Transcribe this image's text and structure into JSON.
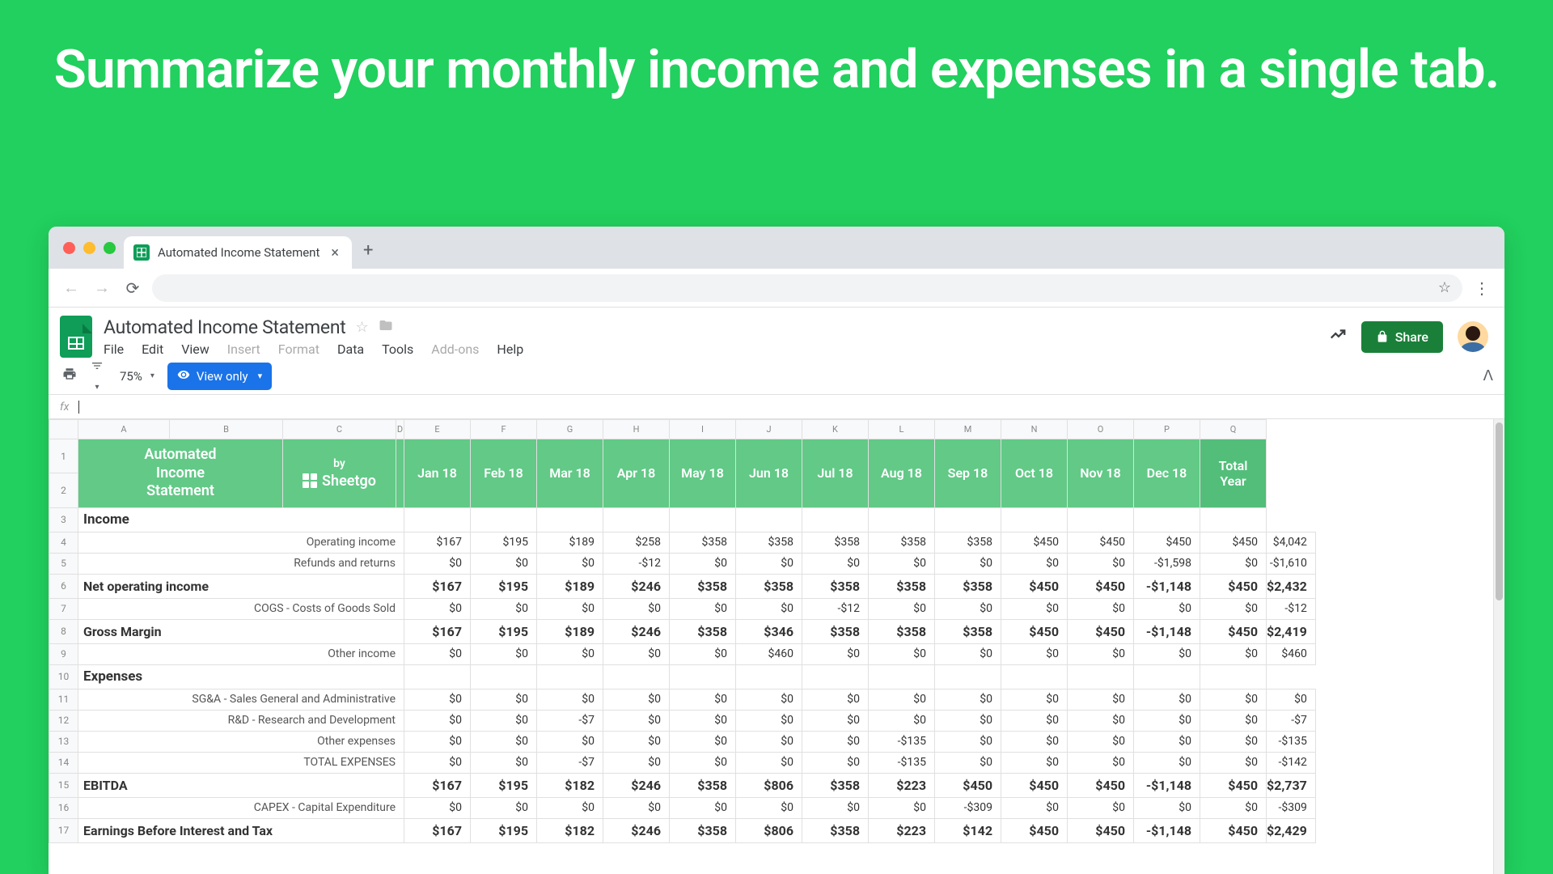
{
  "hero": "Summarize your monthly income and expenses in a single tab.",
  "tab": {
    "title": "Automated Income Statement"
  },
  "doc": {
    "title": "Automated Income Statement",
    "menus": [
      "File",
      "Edit",
      "View",
      "Insert",
      "Format",
      "Data",
      "Tools",
      "Add-ons",
      "Help"
    ],
    "menus_dim": [
      "Insert",
      "Format",
      "Add-ons"
    ],
    "share_label": "Share"
  },
  "toolbar": {
    "zoom": "75%",
    "view_only": "View only"
  },
  "fx": "fx",
  "columns": [
    "A",
    "B",
    "C",
    "D",
    "E",
    "F",
    "G",
    "H",
    "I",
    "J",
    "K",
    "L",
    "M",
    "N",
    "O",
    "P",
    "Q"
  ],
  "header": {
    "left_line1": "Automated Income Statement",
    "brand_by": "by",
    "brand_name": "Sheetgo",
    "months": [
      "Jan 18",
      "Feb 18",
      "Mar 18",
      "Apr 18",
      "May 18",
      "Jun 18",
      "Jul 18",
      "Aug 18",
      "Sep 18",
      "Oct 18",
      "Nov 18",
      "Dec 18"
    ],
    "total": "Total Year"
  },
  "rows": [
    {
      "n": "3",
      "type": "section",
      "label": "Income"
    },
    {
      "n": "4",
      "type": "sub",
      "label": "Operating income",
      "v": [
        "$167",
        "$195",
        "$189",
        "$258",
        "$358",
        "$358",
        "$358",
        "$358",
        "$358",
        "$450",
        "$450",
        "$450",
        "$450",
        "$4,042"
      ]
    },
    {
      "n": "5",
      "type": "sub",
      "label": "Refunds and returns",
      "v": [
        "$0",
        "$0",
        "$0",
        "-$12",
        "$0",
        "$0",
        "$0",
        "$0",
        "$0",
        "$0",
        "$0",
        "-$1,598",
        "$0",
        "-$1,610"
      ]
    },
    {
      "n": "6",
      "type": "strong",
      "label": "Net operating income",
      "v": [
        "$167",
        "$195",
        "$189",
        "$246",
        "$358",
        "$358",
        "$358",
        "$358",
        "$358",
        "$450",
        "$450",
        "-$1,148",
        "$450",
        "$2,432"
      ]
    },
    {
      "n": "7",
      "type": "sub",
      "label": "COGS - Costs of Goods Sold",
      "v": [
        "$0",
        "$0",
        "$0",
        "$0",
        "$0",
        "$0",
        "-$12",
        "$0",
        "$0",
        "$0",
        "$0",
        "$0",
        "$0",
        "-$12"
      ]
    },
    {
      "n": "8",
      "type": "strong",
      "label": "Gross Margin",
      "v": [
        "$167",
        "$195",
        "$189",
        "$246",
        "$358",
        "$346",
        "$358",
        "$358",
        "$358",
        "$450",
        "$450",
        "-$1,148",
        "$450",
        "$2,419"
      ]
    },
    {
      "n": "9",
      "type": "sub",
      "label": "Other income",
      "v": [
        "$0",
        "$0",
        "$0",
        "$0",
        "$0",
        "$460",
        "$0",
        "$0",
        "$0",
        "$0",
        "$0",
        "$0",
        "$0",
        "$460"
      ]
    },
    {
      "n": "10",
      "type": "section",
      "label": "Expenses"
    },
    {
      "n": "11",
      "type": "sub",
      "label": "SG&A - Sales General and Administrative",
      "v": [
        "$0",
        "$0",
        "$0",
        "$0",
        "$0",
        "$0",
        "$0",
        "$0",
        "$0",
        "$0",
        "$0",
        "$0",
        "$0",
        "$0"
      ]
    },
    {
      "n": "12",
      "type": "sub",
      "label": "R&D - Research and Development",
      "v": [
        "$0",
        "$0",
        "-$7",
        "$0",
        "$0",
        "$0",
        "$0",
        "$0",
        "$0",
        "$0",
        "$0",
        "$0",
        "$0",
        "-$7"
      ]
    },
    {
      "n": "13",
      "type": "sub",
      "label": "Other expenses",
      "v": [
        "$0",
        "$0",
        "$0",
        "$0",
        "$0",
        "$0",
        "$0",
        "-$135",
        "$0",
        "$0",
        "$0",
        "$0",
        "$0",
        "-$135"
      ]
    },
    {
      "n": "14",
      "type": "sub",
      "label": "TOTAL EXPENSES",
      "v": [
        "$0",
        "$0",
        "-$7",
        "$0",
        "$0",
        "$0",
        "$0",
        "-$135",
        "$0",
        "$0",
        "$0",
        "$0",
        "$0",
        "-$142"
      ]
    },
    {
      "n": "15",
      "type": "strong",
      "label": "EBITDA",
      "v": [
        "$167",
        "$195",
        "$182",
        "$246",
        "$358",
        "$806",
        "$358",
        "$223",
        "$450",
        "$450",
        "$450",
        "-$1,148",
        "$450",
        "$2,737"
      ]
    },
    {
      "n": "16",
      "type": "sub",
      "label": "CAPEX - Capital Expenditure",
      "v": [
        "$0",
        "$0",
        "$0",
        "$0",
        "$0",
        "$0",
        "$0",
        "$0",
        "-$309",
        "$0",
        "$0",
        "$0",
        "$0",
        "-$309"
      ]
    },
    {
      "n": "17",
      "type": "strong",
      "label": "Earnings Before Interest and Tax",
      "v": [
        "$167",
        "$195",
        "$182",
        "$246",
        "$358",
        "$806",
        "$358",
        "$223",
        "$142",
        "$450",
        "$450",
        "-$1,148",
        "$450",
        "$2,429"
      ]
    }
  ]
}
